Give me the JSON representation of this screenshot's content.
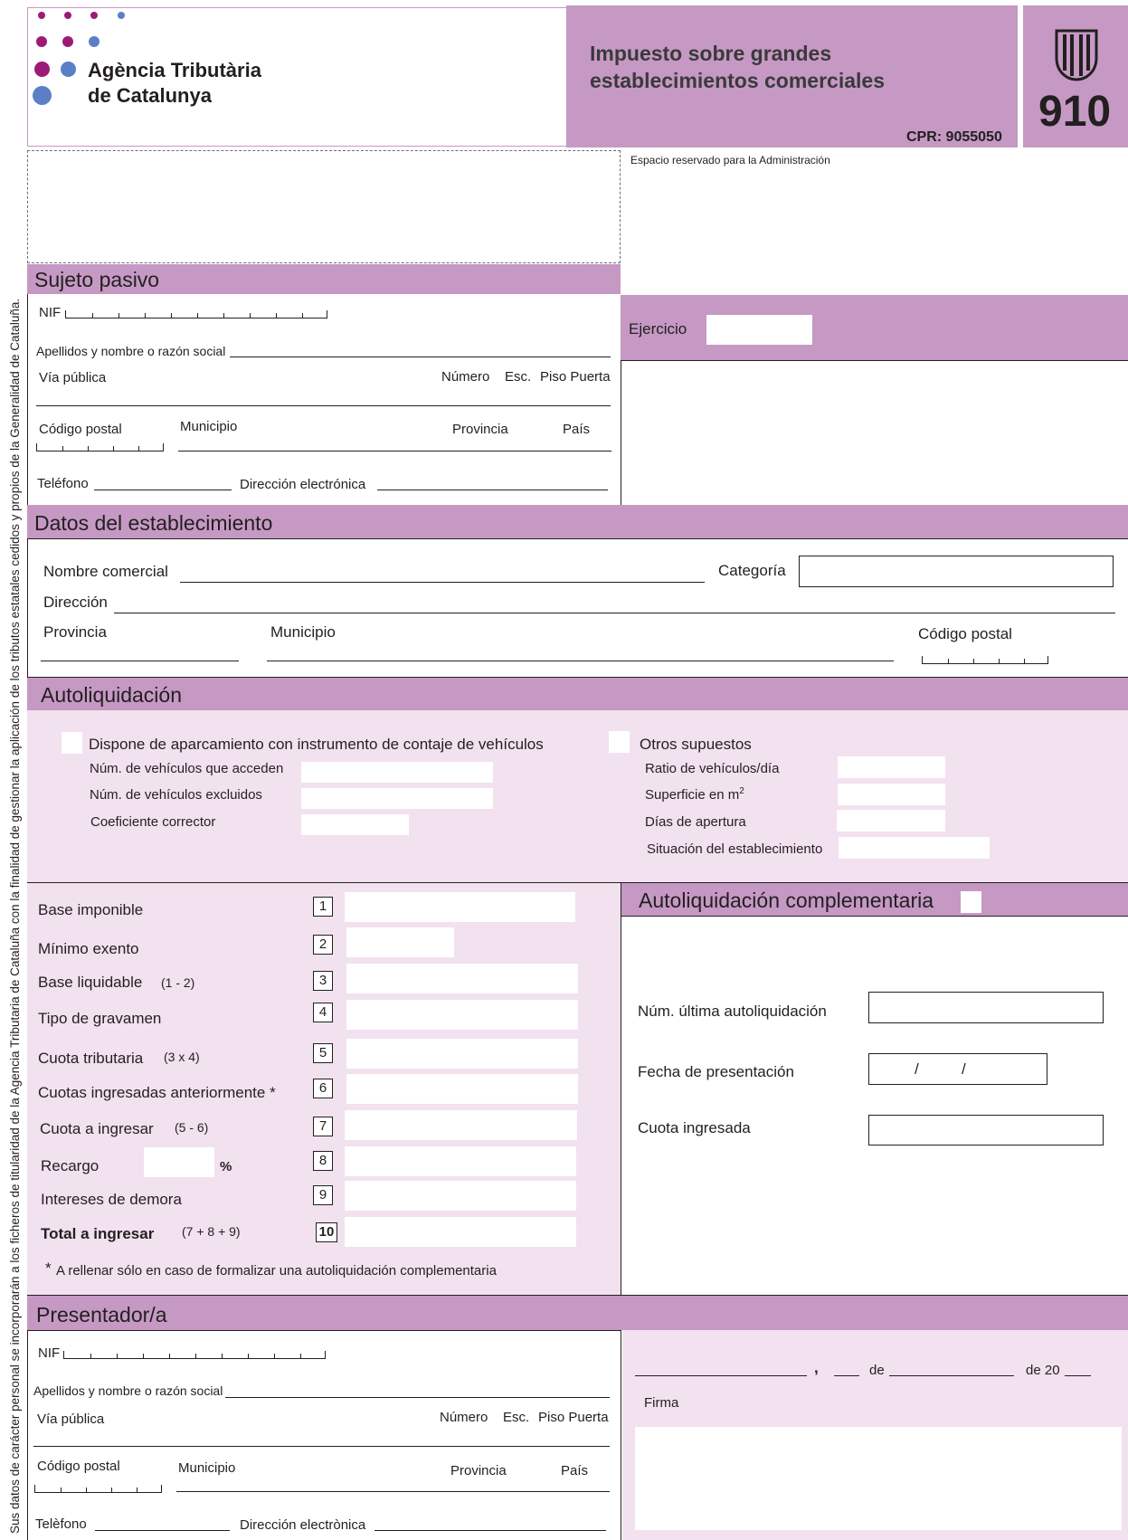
{
  "header": {
    "agency_line1": "Agència Tributària",
    "agency_line2": "de Catalunya",
    "tax_title_line1": "Impuesto sobre grandes",
    "tax_title_line2": "establecimientos comerciales",
    "cpr": "CPR: 9055050",
    "model_number": "910",
    "reserved_admin": "Espacio reservado para la Administración"
  },
  "side_note": "Sus datos de carácter personal se incorporarán a los ficheros de titularidad de la Agencia Tributaria de Cataluña con la finalidad de gestionar la aplicación de los tributos estatales cedidos y propios de la Generalidad de Cataluña.",
  "sujeto": {
    "title": "Sujeto pasivo",
    "nif": "NIF",
    "apellidos": "Apellidos y nombre o razón social",
    "via": "Vía pública",
    "numero": "Número",
    "esc": "Esc.",
    "piso_puerta": "Piso Puerta",
    "cp": "Código postal",
    "municipio": "Municipio",
    "provincia": "Provincia",
    "pais": "País",
    "telefono": "Teléfono",
    "email": "Dirección electrónica"
  },
  "ejercicio": {
    "label": "Ejercicio"
  },
  "establecimiento": {
    "title": "Datos del establecimiento",
    "nombre": "Nombre comercial",
    "categoria": "Categoría",
    "direccion": "Dirección",
    "provincia": "Provincia",
    "municipio": "Municipio",
    "cp": "Código postal"
  },
  "autoliquidacion": {
    "title": "Autoliquidación",
    "opt1": "Dispone de aparcamiento con instrumento de contaje de vehículos",
    "acceden": "Núm. de vehículos que acceden",
    "excluidos": "Núm. de vehículos excluidos",
    "coeficiente": "Coeficiente corrector",
    "opt2": "Otros supuestos",
    "ratio": "Ratio de vehículos/día",
    "superficie": "Superficie en m",
    "superficie_sup": "2",
    "dias": "Días de apertura",
    "situacion": "Situación del establecimiento"
  },
  "calc": {
    "rows": [
      {
        "label": "Base imponible",
        "n": "1",
        "formula": ""
      },
      {
        "label": "Mínimo exento",
        "n": "2",
        "formula": ""
      },
      {
        "label": "Base liquidable",
        "n": "3",
        "formula": "(1 - 2)"
      },
      {
        "label": "Tipo de gravamen",
        "n": "4",
        "formula": ""
      },
      {
        "label": "Cuota tributaria",
        "n": "5",
        "formula": "(3 x 4)"
      },
      {
        "label": "Cuotas ingresadas anteriormente *",
        "n": "6",
        "formula": ""
      },
      {
        "label": "Cuota a ingresar",
        "n": "7",
        "formula": "(5 - 6)"
      },
      {
        "label": "Recargo",
        "n": "8",
        "formula": ""
      },
      {
        "label": "Intereses de demora",
        "n": "9",
        "formula": ""
      },
      {
        "label": "Total a ingresar",
        "n": "10",
        "formula": "(7 + 8 + 9)"
      }
    ],
    "percent": "%",
    "footnote_star": "*",
    "footnote": "A rellenar sólo en caso de formalizar una autoliquidación complementaria"
  },
  "complementaria": {
    "title": "Autoliquidación complementaria",
    "ultima": "Núm. última autoliquidación",
    "fecha": "Fecha de presentación",
    "fecha_sep": "/          /",
    "cuota": "Cuota ingresada"
  },
  "presentador": {
    "title": "Presentador/a",
    "nif": "NIF",
    "apellidos": "Apellidos y nombre o razón social",
    "via": "Vía pública",
    "numero": "Número",
    "esc": "Esc.",
    "piso_puerta": "Piso Puerta",
    "cp": "Código postal",
    "municipio": "Municipio",
    "provincia": "Provincia",
    "pais": "País",
    "telefono": "Telèfono",
    "email": "Dirección electrònica"
  },
  "firma": {
    "comma": ",",
    "de1": "de",
    "de2": "de 20",
    "label": "Firma"
  },
  "colors": {
    "band": "#c599c4",
    "pink_bg": "#f2e1ef",
    "dot_purple": "#9c1b77",
    "dot_blue": "#5b7fc7"
  }
}
